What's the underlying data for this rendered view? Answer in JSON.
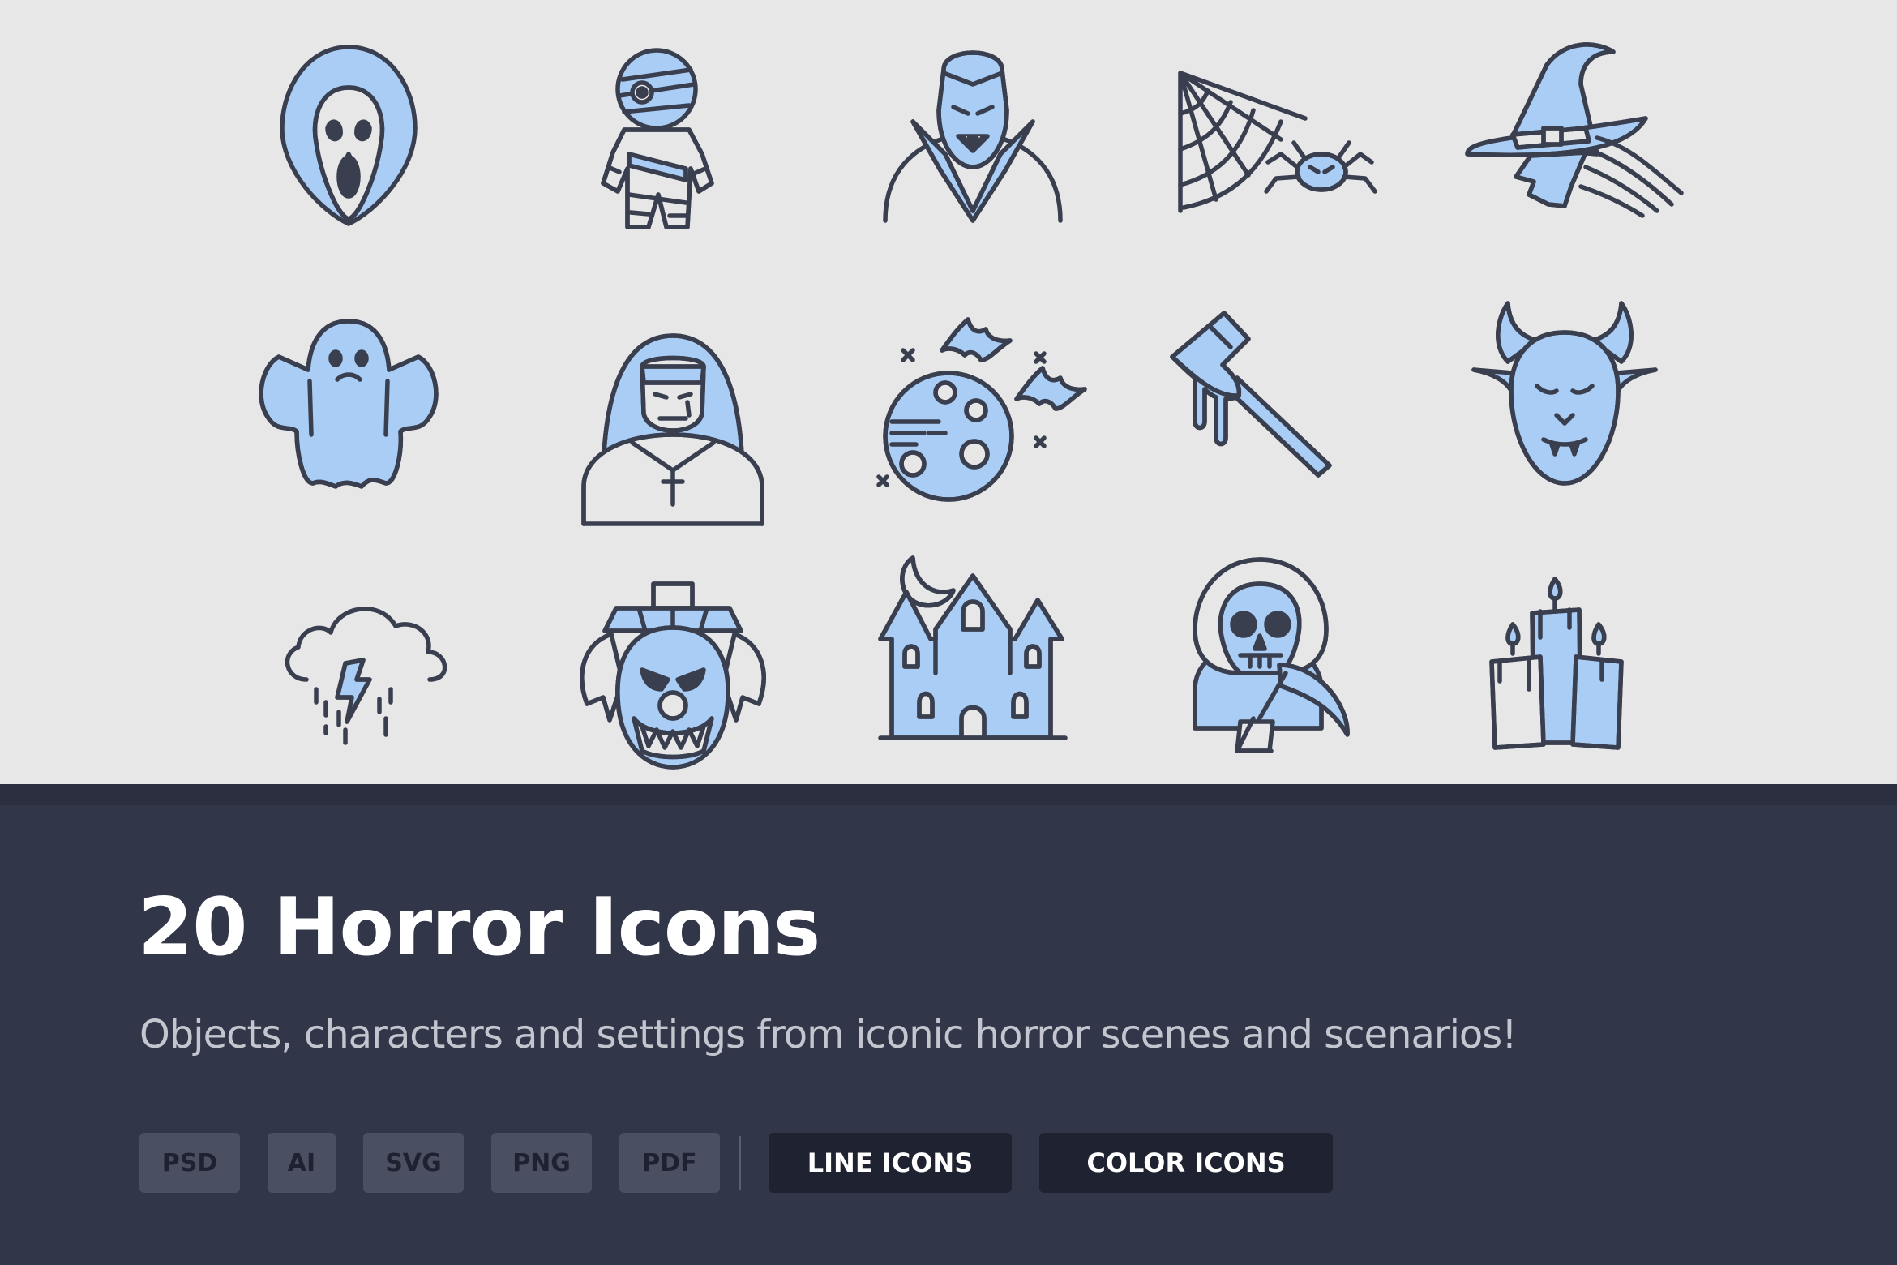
{
  "icons": [
    {
      "name": "scream-ghostface-icon"
    },
    {
      "name": "mummy-icon"
    },
    {
      "name": "vampire-icon"
    },
    {
      "name": "spider-web-icon"
    },
    {
      "name": "witch-icon"
    },
    {
      "name": "ghost-icon"
    },
    {
      "name": "nun-icon"
    },
    {
      "name": "moon-bats-icon"
    },
    {
      "name": "bloody-axe-icon"
    },
    {
      "name": "devil-icon"
    },
    {
      "name": "storm-cloud-icon"
    },
    {
      "name": "evil-clown-icon"
    },
    {
      "name": "haunted-castle-icon"
    },
    {
      "name": "grim-reaper-icon"
    },
    {
      "name": "candles-icon"
    }
  ],
  "colors": {
    "top_background": "#e7e7e8",
    "bottom_background": "#323649",
    "icon_fill": "#a9cdf5",
    "icon_stroke": "#3a3f4f"
  },
  "banner": {
    "title": "20 Horror Icons",
    "subtitle": "Objects, characters and settings from iconic horror scenes and scenarios!",
    "formats": [
      "PSD",
      "AI",
      "SVG",
      "PNG",
      "PDF"
    ],
    "buttons": [
      "LINE ICONS",
      "COLOR ICONS"
    ]
  }
}
